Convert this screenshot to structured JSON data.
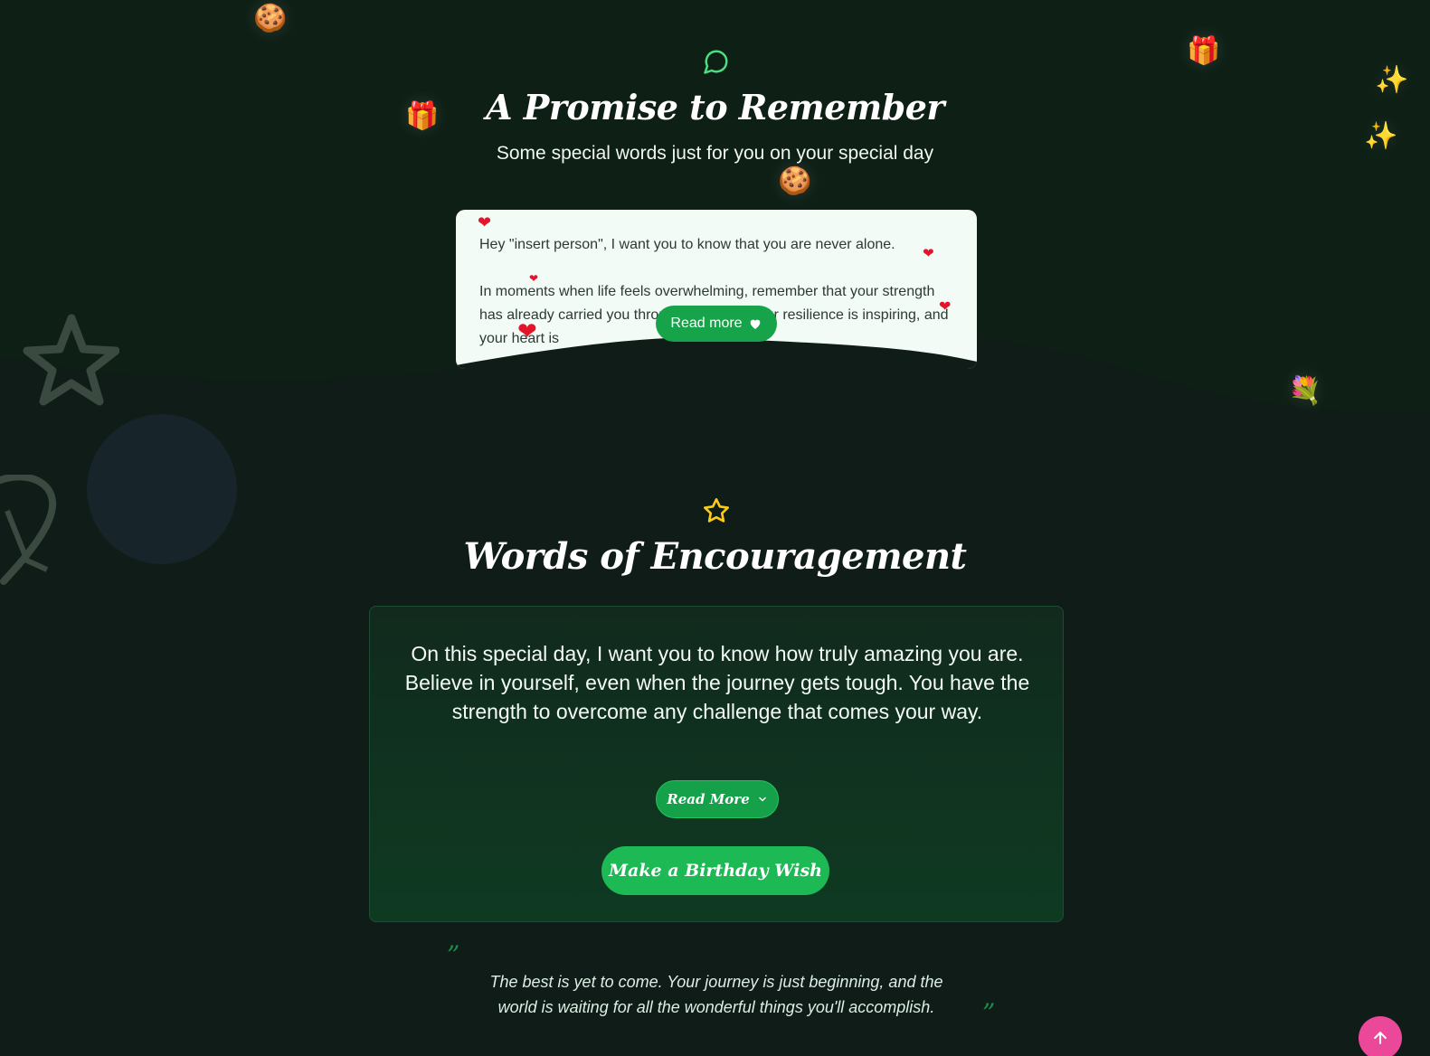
{
  "promise_section": {
    "title": "A Promise to Remember",
    "subtitle": "Some special words just for you on your special day",
    "paragraph_1": "Hey \"insert person\", I want you to know that you are never alone.",
    "paragraph_2": "In moments when life feels overwhelming, remember that your strength has already carried you through so much. Your resilience is inspiring, and your heart is",
    "read_more_label": "Read more",
    "read_more_icon": "heart-icon"
  },
  "encouragement_section": {
    "title": "Words of Encouragement",
    "message": "On this special day, I want you to know how truly amazing you are. Believe in yourself, even when the journey gets tough. You have the strength to overcome any challenge that comes your way.",
    "read_more_label": "Read More",
    "wish_button_label": "Make a Birthday Wish"
  },
  "quote": {
    "text": "The best is yet to come. Your journey is just beginning, and the world is waiting for all the wonderful things you'll accomplish.",
    "open_mark": "”",
    "close_mark": "”"
  },
  "decorations": {
    "cookie": "🍪",
    "gift": "🎁",
    "sparkles": "✨",
    "balloon": "🎈",
    "bouquet": "💐",
    "heart": "❤"
  },
  "colors": {
    "background": "#0f1c17",
    "accent_green": "#16a34a",
    "button_green": "#1db954",
    "scroll_top_pink": "#ec4899",
    "star_yellow": "#facc15"
  }
}
